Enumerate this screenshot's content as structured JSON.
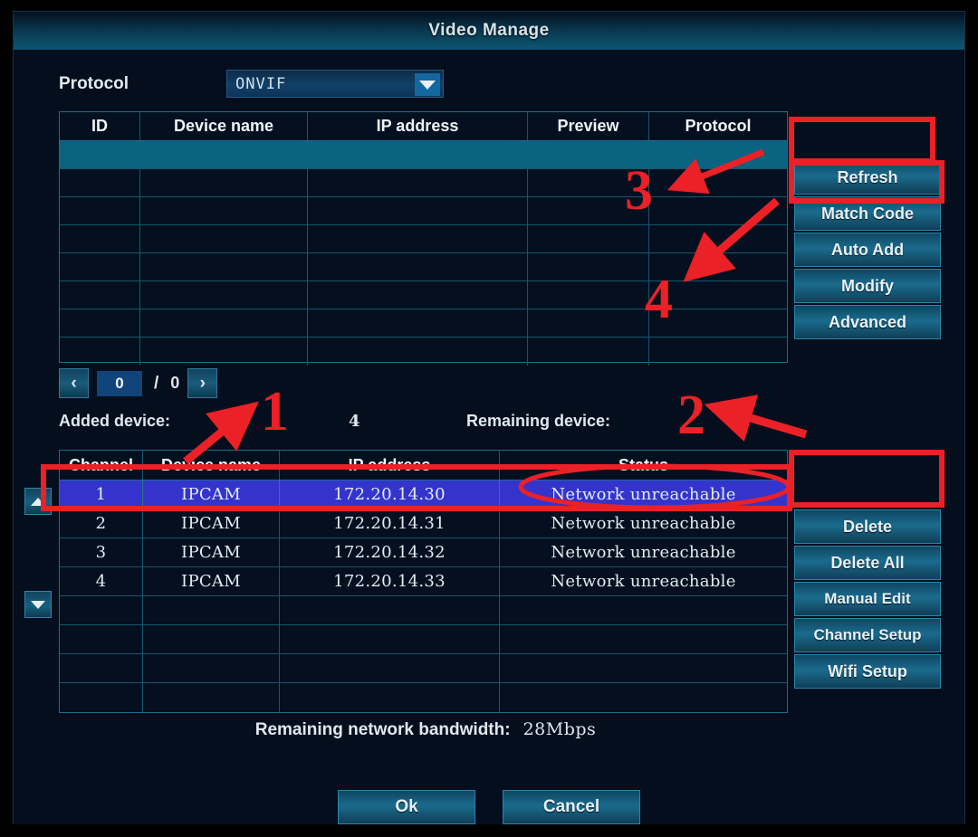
{
  "window": {
    "title": "Video Manage"
  },
  "protocol": {
    "label": "Protocol",
    "value": "ONVIF",
    "dropdown_icon": "chevron-down-icon"
  },
  "discovery_table": {
    "headers": [
      "ID",
      "Device name",
      "IP address",
      "Preview",
      "Protocol"
    ],
    "rows": [
      {
        "id": "",
        "device_name": "",
        "ip_address": "",
        "preview": "",
        "protocol": "",
        "selected": true
      },
      {
        "id": "",
        "device_name": "",
        "ip_address": "",
        "preview": "",
        "protocol": "",
        "selected": false
      },
      {
        "id": "",
        "device_name": "",
        "ip_address": "",
        "preview": "",
        "protocol": "",
        "selected": false
      },
      {
        "id": "",
        "device_name": "",
        "ip_address": "",
        "preview": "",
        "protocol": "",
        "selected": false
      },
      {
        "id": "",
        "device_name": "",
        "ip_address": "",
        "preview": "",
        "protocol": "",
        "selected": false
      },
      {
        "id": "",
        "device_name": "",
        "ip_address": "",
        "preview": "",
        "protocol": "",
        "selected": false
      },
      {
        "id": "",
        "device_name": "",
        "ip_address": "",
        "preview": "",
        "protocol": "",
        "selected": false
      },
      {
        "id": "",
        "device_name": "",
        "ip_address": "",
        "preview": "",
        "protocol": "",
        "selected": false
      }
    ]
  },
  "pagination": {
    "prev_label": "‹",
    "current_page": "0",
    "separator": "/",
    "total_pages": "0",
    "next_label": "›"
  },
  "counters": {
    "added_label": "Added device:",
    "added_value": "4",
    "remaining_label": "Remaining device:",
    "remaining_value": ""
  },
  "added_table": {
    "headers": [
      "Channel",
      "Device name",
      "IP address",
      "Status"
    ],
    "rows": [
      {
        "channel": "1",
        "device_name": "IPCAM",
        "ip_address": "172.20.14.30",
        "status": "Network unreachable",
        "selected": true
      },
      {
        "channel": "2",
        "device_name": "IPCAM",
        "ip_address": "172.20.14.31",
        "status": "Network unreachable",
        "selected": false
      },
      {
        "channel": "3",
        "device_name": "IPCAM",
        "ip_address": "172.20.14.32",
        "status": "Network unreachable",
        "selected": false
      },
      {
        "channel": "4",
        "device_name": "IPCAM",
        "ip_address": "172.20.14.33",
        "status": "Network unreachable",
        "selected": false
      },
      {
        "channel": "",
        "device_name": "",
        "ip_address": "",
        "status": "",
        "selected": false
      },
      {
        "channel": "",
        "device_name": "",
        "ip_address": "",
        "status": "",
        "selected": false
      },
      {
        "channel": "",
        "device_name": "",
        "ip_address": "",
        "status": "",
        "selected": false
      },
      {
        "channel": "",
        "device_name": "",
        "ip_address": "",
        "status": "",
        "selected": false
      }
    ]
  },
  "discovery_buttons": [
    {
      "label": "Refresh",
      "name": "refresh-button"
    },
    {
      "label": "Match Code",
      "name": "match-code-button"
    },
    {
      "label": "Auto Add",
      "name": "auto-add-button"
    },
    {
      "label": "Modify",
      "name": "modify-button"
    },
    {
      "label": "Advanced",
      "name": "advanced-button"
    }
  ],
  "added_buttons": [
    {
      "label": "Delete",
      "name": "delete-button"
    },
    {
      "label": "Delete All",
      "name": "delete-all-button"
    },
    {
      "label": "Manual Edit",
      "name": "manual-edit-button"
    },
    {
      "label": "Channel Setup",
      "name": "channel-setup-button"
    },
    {
      "label": "Wifi Setup",
      "name": "wifi-setup-button"
    }
  ],
  "scroll": {
    "up_icon": "triangle-up-icon",
    "down_icon": "triangle-down-icon"
  },
  "bandwidth": {
    "label": "Remaining network bandwidth:",
    "value": "28Mbps"
  },
  "footer": {
    "ok_label": "Ok",
    "cancel_label": "Cancel"
  },
  "annotations": {
    "marker_1": "1",
    "marker_2": "2",
    "marker_3": "3",
    "marker_4": "4",
    "color": "#ec2027"
  }
}
